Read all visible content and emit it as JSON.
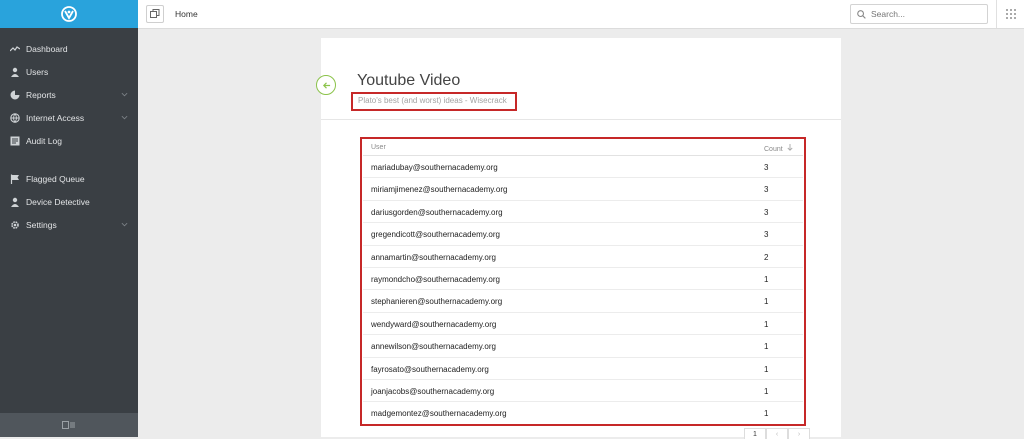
{
  "app": {
    "logo_icon": "shield-logo-icon",
    "accent": "#29a3dc"
  },
  "sidebar": {
    "items": [
      {
        "label": "Dashboard",
        "icon": "activity-icon"
      },
      {
        "label": "Users",
        "icon": "user-icon"
      },
      {
        "label": "Reports",
        "icon": "pie-chart-icon",
        "has_submenu": true
      },
      {
        "label": "Internet Access",
        "icon": "globe-icon",
        "has_submenu": true
      },
      {
        "label": "Audit Log",
        "icon": "list-icon"
      }
    ],
    "items_secondary": [
      {
        "label": "Flagged Queue",
        "icon": "flag-icon"
      },
      {
        "label": "Device Detective",
        "icon": "user-icon"
      },
      {
        "label": "Settings",
        "icon": "gear-icon",
        "has_submenu": true
      }
    ],
    "footer_icon": "collapse-sidebar-icon"
  },
  "topbar": {
    "breadcrumb": "Home",
    "search_placeholder": "Search..."
  },
  "main": {
    "title": "Youtube Video",
    "subtitle": "Plato's best (and worst) ideas - Wisecrack",
    "table": {
      "col_user": "User",
      "col_count": "Count",
      "rows": [
        {
          "user": "mariadubay@southernacademy.org",
          "count": "3"
        },
        {
          "user": "miriamjimenez@southernacademy.org",
          "count": "3"
        },
        {
          "user": "dariusgorden@southernacademy.org",
          "count": "3"
        },
        {
          "user": "gregendicott@southernacademy.org",
          "count": "3"
        },
        {
          "user": "annamartin@southernacademy.org",
          "count": "2"
        },
        {
          "user": "raymondcho@southernacademy.org",
          "count": "1"
        },
        {
          "user": "stephanieren@southernacademy.org",
          "count": "1"
        },
        {
          "user": "wendyward@southernacademy.org",
          "count": "1"
        },
        {
          "user": "annewilson@southernacademy.org",
          "count": "1"
        },
        {
          "user": "fayrosato@southernacademy.org",
          "count": "1"
        },
        {
          "user": "joanjacobs@southernacademy.org",
          "count": "1"
        },
        {
          "user": "madgemontez@southernacademy.org",
          "count": "1"
        }
      ]
    },
    "pagination": {
      "current_page": "1"
    }
  }
}
